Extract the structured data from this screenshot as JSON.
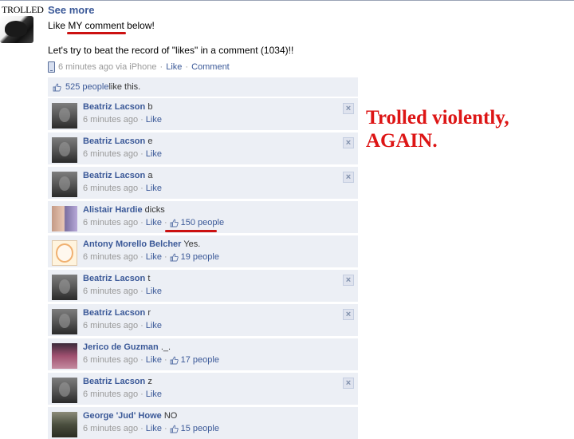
{
  "post": {
    "author_name": "TROLLED",
    "see_more": "See more",
    "line1_before": "Like ",
    "line1_highlight": "MY comment",
    "line1_after": " below!",
    "line2": "Let's try to beat the record of \"likes\" in a comment (1034)!!",
    "meta_time": "6 minutes ago via iPhone",
    "meta_like": "Like",
    "meta_comment": "Comment",
    "likes_count_text": "525 people",
    "likes_suffix": " like this."
  },
  "comments": [
    {
      "name": "Beatriz Lacson",
      "text": "b",
      "time": "6 minutes ago",
      "like": "Like",
      "likes": ""
    },
    {
      "name": "Beatriz Lacson",
      "text": "e",
      "time": "6 minutes ago",
      "like": "Like",
      "likes": ""
    },
    {
      "name": "Beatriz Lacson",
      "text": "a",
      "time": "6 minutes ago",
      "like": "Like",
      "likes": ""
    },
    {
      "name": "Alistair Hardie",
      "text": "dicks",
      "time": "6 minutes ago",
      "like": "Like",
      "likes": "150 people"
    },
    {
      "name": "Antony Morello Belcher",
      "text": "Yes.",
      "time": "6 minutes ago",
      "like": "Like",
      "likes": "19 people"
    },
    {
      "name": "Beatriz Lacson",
      "text": "t",
      "time": "6 minutes ago",
      "like": "Like",
      "likes": ""
    },
    {
      "name": "Beatriz Lacson",
      "text": "r",
      "time": "6 minutes ago",
      "like": "Like",
      "likes": ""
    },
    {
      "name": "Jerico de Guzman",
      "text": "._.",
      "time": "6 minutes ago",
      "like": "Like",
      "likes": "17 people"
    },
    {
      "name": "Beatriz Lacson",
      "text": "z",
      "time": "6 minutes ago",
      "like": "Like",
      "likes": ""
    },
    {
      "name": "George 'Jud' Howe",
      "text": "NO",
      "time": "6 minutes ago",
      "like": "Like",
      "likes": "15 people"
    }
  ],
  "close_glyph": "×",
  "annotation": {
    "line1": "Trolled violently,",
    "line2": "AGAIN."
  },
  "colors": {
    "link": "#3b5998",
    "comment_bg": "#eceff5",
    "annotation_red": "#dd1515"
  },
  "icons": [
    "thumbs-up-icon",
    "phone-icon",
    "close-icon"
  ]
}
